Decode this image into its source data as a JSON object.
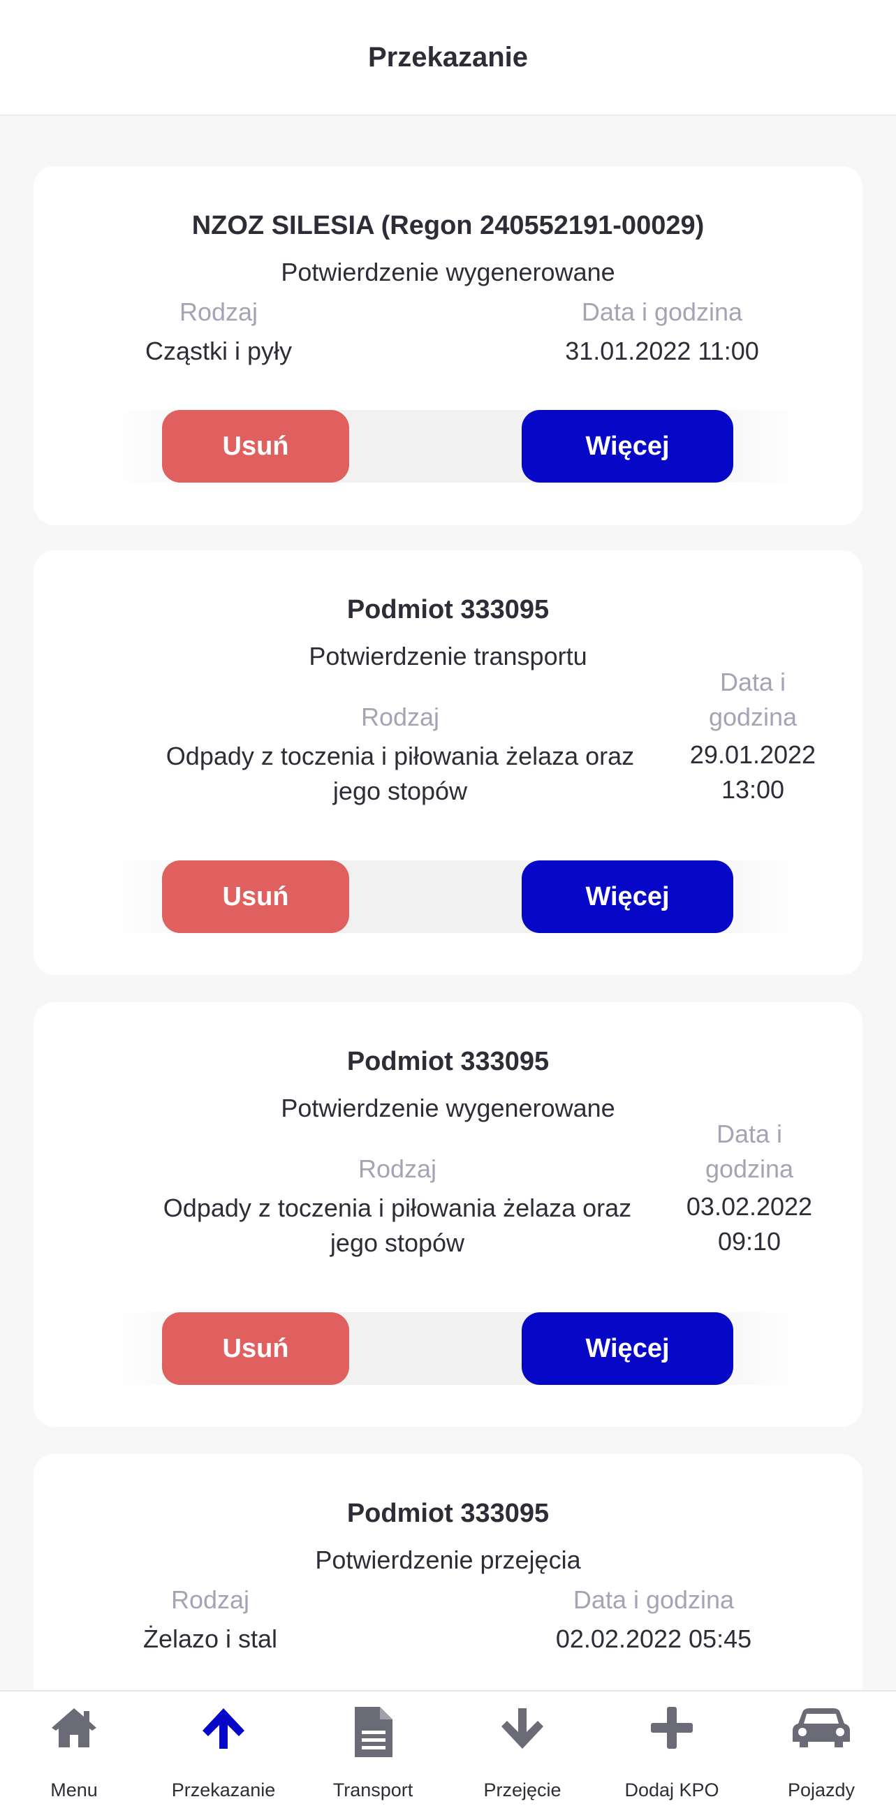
{
  "header": {
    "title": "Przekazanie"
  },
  "labels": {
    "kind": "Rodzaj",
    "datetime": "Data i godzina",
    "datetime_line1": "Data i",
    "datetime_line2": "godzina"
  },
  "buttons": {
    "delete": "Usuń",
    "more": "Więcej"
  },
  "cards": [
    {
      "title": "NZOZ SILESIA (Regon 240552191-00029)",
      "status": "Potwierdzenie wygenerowane",
      "kind": "Cząstki i pyły",
      "date": "31.01.2022 11:00"
    },
    {
      "title": "Podmiot 333095",
      "status": "Potwierdzenie transportu",
      "kind_line1": "Odpady z toczenia i piłowania żelaza oraz",
      "kind_line2": "jego stopów",
      "date_line1": "29.01.2022",
      "date_line2": "13:00"
    },
    {
      "title": "Podmiot 333095",
      "status": "Potwierdzenie wygenerowane",
      "kind_line1": "Odpady z toczenia i piłowania żelaza oraz",
      "kind_line2": "jego stopów",
      "date_line1": "03.02.2022",
      "date_line2": "09:10"
    },
    {
      "title": "Podmiot 333095",
      "status": "Potwierdzenie przejęcia",
      "kind": "Żelazo i stal",
      "date": "02.02.2022 05:45"
    }
  ],
  "tabbar": {
    "active_color": "#0707c8",
    "inactive_color": "#6b6b78",
    "items": [
      {
        "label": "Menu",
        "icon": "home-icon"
      },
      {
        "label": "Przekazanie",
        "icon": "arrow-up-icon",
        "active": true
      },
      {
        "label": "Transport",
        "icon": "document-icon"
      },
      {
        "label": "Przejęcie",
        "icon": "arrow-down-icon"
      },
      {
        "label": "Dodaj KPO",
        "icon": "plus-icon"
      },
      {
        "label": "Pojazdy",
        "icon": "car-icon"
      }
    ]
  }
}
